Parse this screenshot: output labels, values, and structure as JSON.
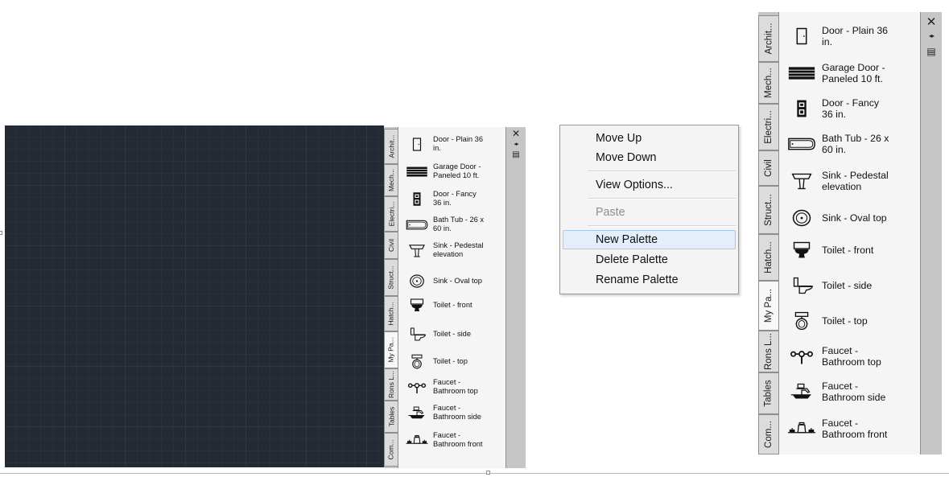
{
  "palette": {
    "tabs": [
      {
        "label": "Archit..."
      },
      {
        "label": "Mech..."
      },
      {
        "label": "Electri..."
      },
      {
        "label": "Civil"
      },
      {
        "label": "Struct..."
      },
      {
        "label": "Hatch..."
      },
      {
        "label": "My Pa...",
        "active": true
      },
      {
        "label": "Rons L..."
      },
      {
        "label": "Tables"
      },
      {
        "label": "Com..."
      }
    ],
    "tools": [
      {
        "line1": "Door - Plain 36",
        "line2": "in.",
        "icon": "door-plain-icon"
      },
      {
        "line1": "Garage Door -",
        "line2": "Paneled 10 ft.",
        "icon": "garage-door-icon"
      },
      {
        "line1": "Door - Fancy",
        "line2": "36 in.",
        "icon": "door-fancy-icon"
      },
      {
        "line1": "Bath Tub - 26 x",
        "line2": "60 in.",
        "icon": "bath-tub-icon"
      },
      {
        "line1": "Sink - Pedestal",
        "line2": "elevation",
        "icon": "sink-pedestal-icon"
      },
      {
        "line1": "Sink - Oval top",
        "line2": "",
        "icon": "sink-oval-icon"
      },
      {
        "line1": "Toilet - front",
        "line2": "",
        "icon": "toilet-front-icon"
      },
      {
        "line1": "Toilet - side",
        "line2": "",
        "icon": "toilet-side-icon"
      },
      {
        "line1": "Toilet - top",
        "line2": "",
        "icon": "toilet-top-icon"
      },
      {
        "line1": "Faucet -",
        "line2": "Bathroom top",
        "icon": "faucet-top-icon"
      },
      {
        "line1": "Faucet -",
        "line2": "Bathroom side",
        "icon": "faucet-side-icon"
      },
      {
        "line1": "Faucet -",
        "line2": "Bathroom front",
        "icon": "faucet-front-icon"
      }
    ],
    "controls": {
      "close": "✕",
      "autohide": "◂▸",
      "properties": "▤"
    }
  },
  "context_menu": {
    "items": [
      {
        "label": "Move Up"
      },
      {
        "label": "Move Down"
      },
      {
        "sep": true
      },
      {
        "label": "View Options..."
      },
      {
        "sep": true
      },
      {
        "label": "Paste",
        "disabled": true
      },
      {
        "sep": true
      },
      {
        "label": "New Palette",
        "hover": true
      },
      {
        "label": "Delete Palette"
      },
      {
        "label": "Rename Palette"
      }
    ]
  },
  "colors": {
    "canvas": "#232a34",
    "palette_frame": "#c6c6c6",
    "palette_content": "#f5f5f5",
    "menu_hover": "#e4eefa"
  }
}
